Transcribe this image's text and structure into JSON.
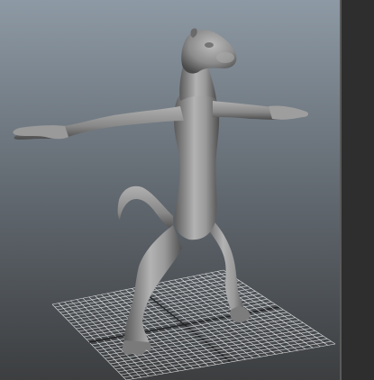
{
  "viewport": {
    "background_top": "#8d99a4",
    "background_bottom": "#3c3e40"
  },
  "model": {
    "name": "",
    "skin_light": "#bdbdbd",
    "skin_mid": "#8a8a8a",
    "skin_dark": "#4a4a4a"
  },
  "grid": {
    "line_color": "#ffffff",
    "axis_color": "#1a1a1a",
    "divisions": 28
  },
  "side_panel": {
    "color": "#2e2e2e"
  }
}
